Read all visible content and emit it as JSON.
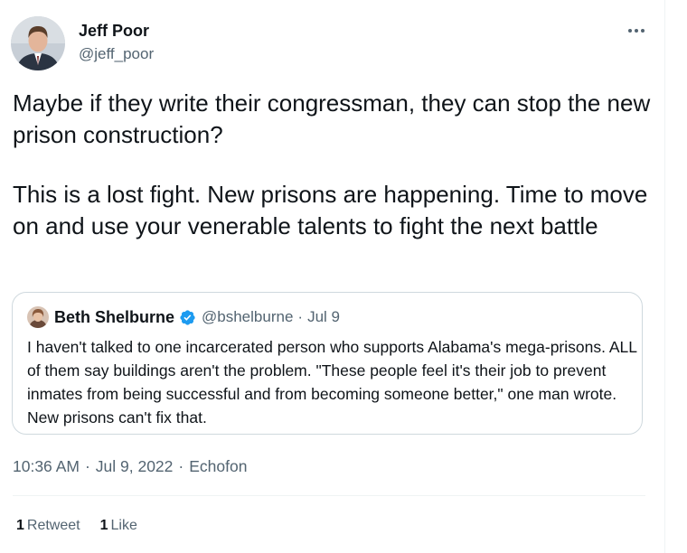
{
  "author": {
    "display_name": "Jeff Poor",
    "handle": "@jeff_poor",
    "avatar_icon": "profile-photo"
  },
  "more_icon": "more-horizontal-icon",
  "tweet": {
    "paragraphs": [
      "Maybe if they write their congressman, they can stop the new prison construction?",
      "This is a lost fight. New prisons are happening. Time to move on and use your venerable talents to fight the next battle"
    ]
  },
  "quote": {
    "display_name": "Beth Shelburne",
    "handle": "@bshelburne",
    "separator": "·",
    "date": "Jul 9",
    "verified_icon": "verified-badge-icon",
    "text": "I haven't talked to one incarcerated person who supports Alabama's mega-prisons. ALL of them say buildings aren't the problem. \"These people feel it's their job to prevent inmates from being successful and from becoming someone better,\" one man wrote. New prisons can't fix that."
  },
  "meta": {
    "time": "10:36 AM",
    "separator": "·",
    "date": "Jul 9, 2022",
    "source": "Echofon"
  },
  "stats": {
    "retweets_count": "1",
    "retweets_label": "Retweet",
    "likes_count": "1",
    "likes_label": "Like"
  },
  "colors": {
    "text_primary": "#0f1419",
    "text_secondary": "#536471",
    "border": "#cfd9de",
    "verified_blue": "#1d9bf0"
  }
}
